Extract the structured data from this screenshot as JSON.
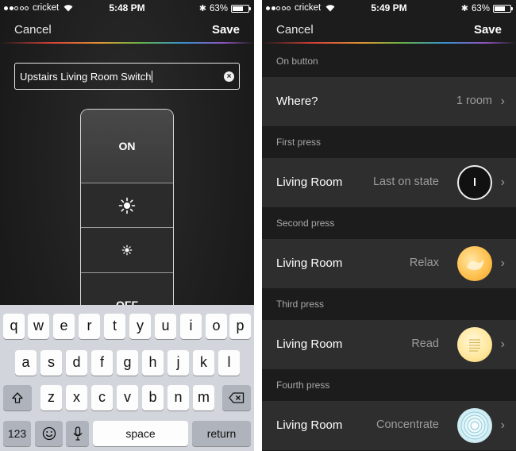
{
  "left": {
    "status": {
      "carrier": "cricket",
      "time": "5:48 PM",
      "battery": "63%"
    },
    "nav": {
      "cancel": "Cancel",
      "save": "Save"
    },
    "name_input": {
      "value": "Upstairs Living Room Switch"
    },
    "switch": {
      "on_label": "ON",
      "off_label": "OFF",
      "up_icon": "brightness-up-icon",
      "down_icon": "brightness-down-icon"
    },
    "keyboard": {
      "row1": [
        "q",
        "w",
        "e",
        "r",
        "t",
        "y",
        "u",
        "i",
        "o",
        "p"
      ],
      "row2": [
        "a",
        "s",
        "d",
        "f",
        "g",
        "h",
        "j",
        "k",
        "l"
      ],
      "row3": [
        "z",
        "x",
        "c",
        "v",
        "b",
        "n",
        "m"
      ],
      "numbers_key": "123",
      "space_key": "space",
      "return_key": "return"
    }
  },
  "right": {
    "status": {
      "carrier": "cricket",
      "time": "5:49 PM",
      "battery": "63%"
    },
    "nav": {
      "cancel": "Cancel",
      "save": "Save"
    },
    "on_button": {
      "section_label": "On button",
      "where_label": "Where?",
      "where_value": "1 room"
    },
    "presses": [
      {
        "label": "First press",
        "room": "Living Room",
        "scene": "Last on state",
        "icon": "last-on-state-icon"
      },
      {
        "label": "Second press",
        "room": "Living Room",
        "scene": "Relax",
        "icon": "relax-scene-icon"
      },
      {
        "label": "Third press",
        "room": "Living Room",
        "scene": "Read",
        "icon": "read-scene-icon"
      },
      {
        "label": "Fourth press",
        "room": "Living Room",
        "scene": "Concentrate",
        "icon": "concentrate-scene-icon"
      }
    ],
    "colors": {
      "relax": "#ffc14f",
      "read": "#ffe69a",
      "concentrate": "#a9dbe8"
    }
  }
}
